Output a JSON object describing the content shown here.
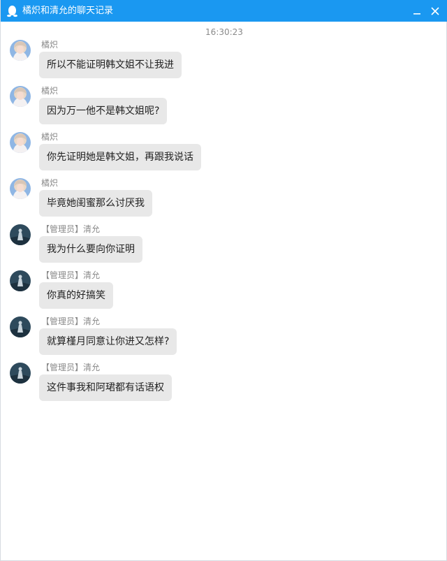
{
  "window": {
    "title": "橘炽和清允的聊天记录"
  },
  "chat": {
    "timestamp": "16:30:23",
    "messages": [
      {
        "sender": "橘炽",
        "text": "所以不能证明韩文姐不让我进",
        "avatar": "girl-avatar"
      },
      {
        "sender": "橘炽",
        "text": "因为万一他不是韩文姐呢?",
        "avatar": "girl-avatar"
      },
      {
        "sender": "橘炽",
        "text": "你先证明她是韩文姐，再跟我说话",
        "avatar": "girl-avatar"
      },
      {
        "sender": "橘炽",
        "text": "毕竟她闺蜜那么讨厌我",
        "avatar": "girl-avatar"
      },
      {
        "sender": "【管理员】清允",
        "text": "我为什么要向你证明",
        "avatar": "dark-avatar"
      },
      {
        "sender": "【管理员】清允",
        "text": "你真的好搞笑",
        "avatar": "dark-avatar"
      },
      {
        "sender": "【管理员】清允",
        "text": "就算槿月同意让你进又怎样?",
        "avatar": "dark-avatar"
      },
      {
        "sender": "【管理员】清允",
        "text": "这件事我和阿珺都有话语权",
        "avatar": "dark-avatar"
      }
    ]
  },
  "colors": {
    "titlebar": "#1a98f1",
    "bubble": "#e8e8e8",
    "meta_text": "#8a8a8a",
    "message_text": "#222222"
  },
  "icons": {
    "app": "qq-penguin-icon",
    "minimize": "minimize-icon",
    "close": "close-icon"
  }
}
